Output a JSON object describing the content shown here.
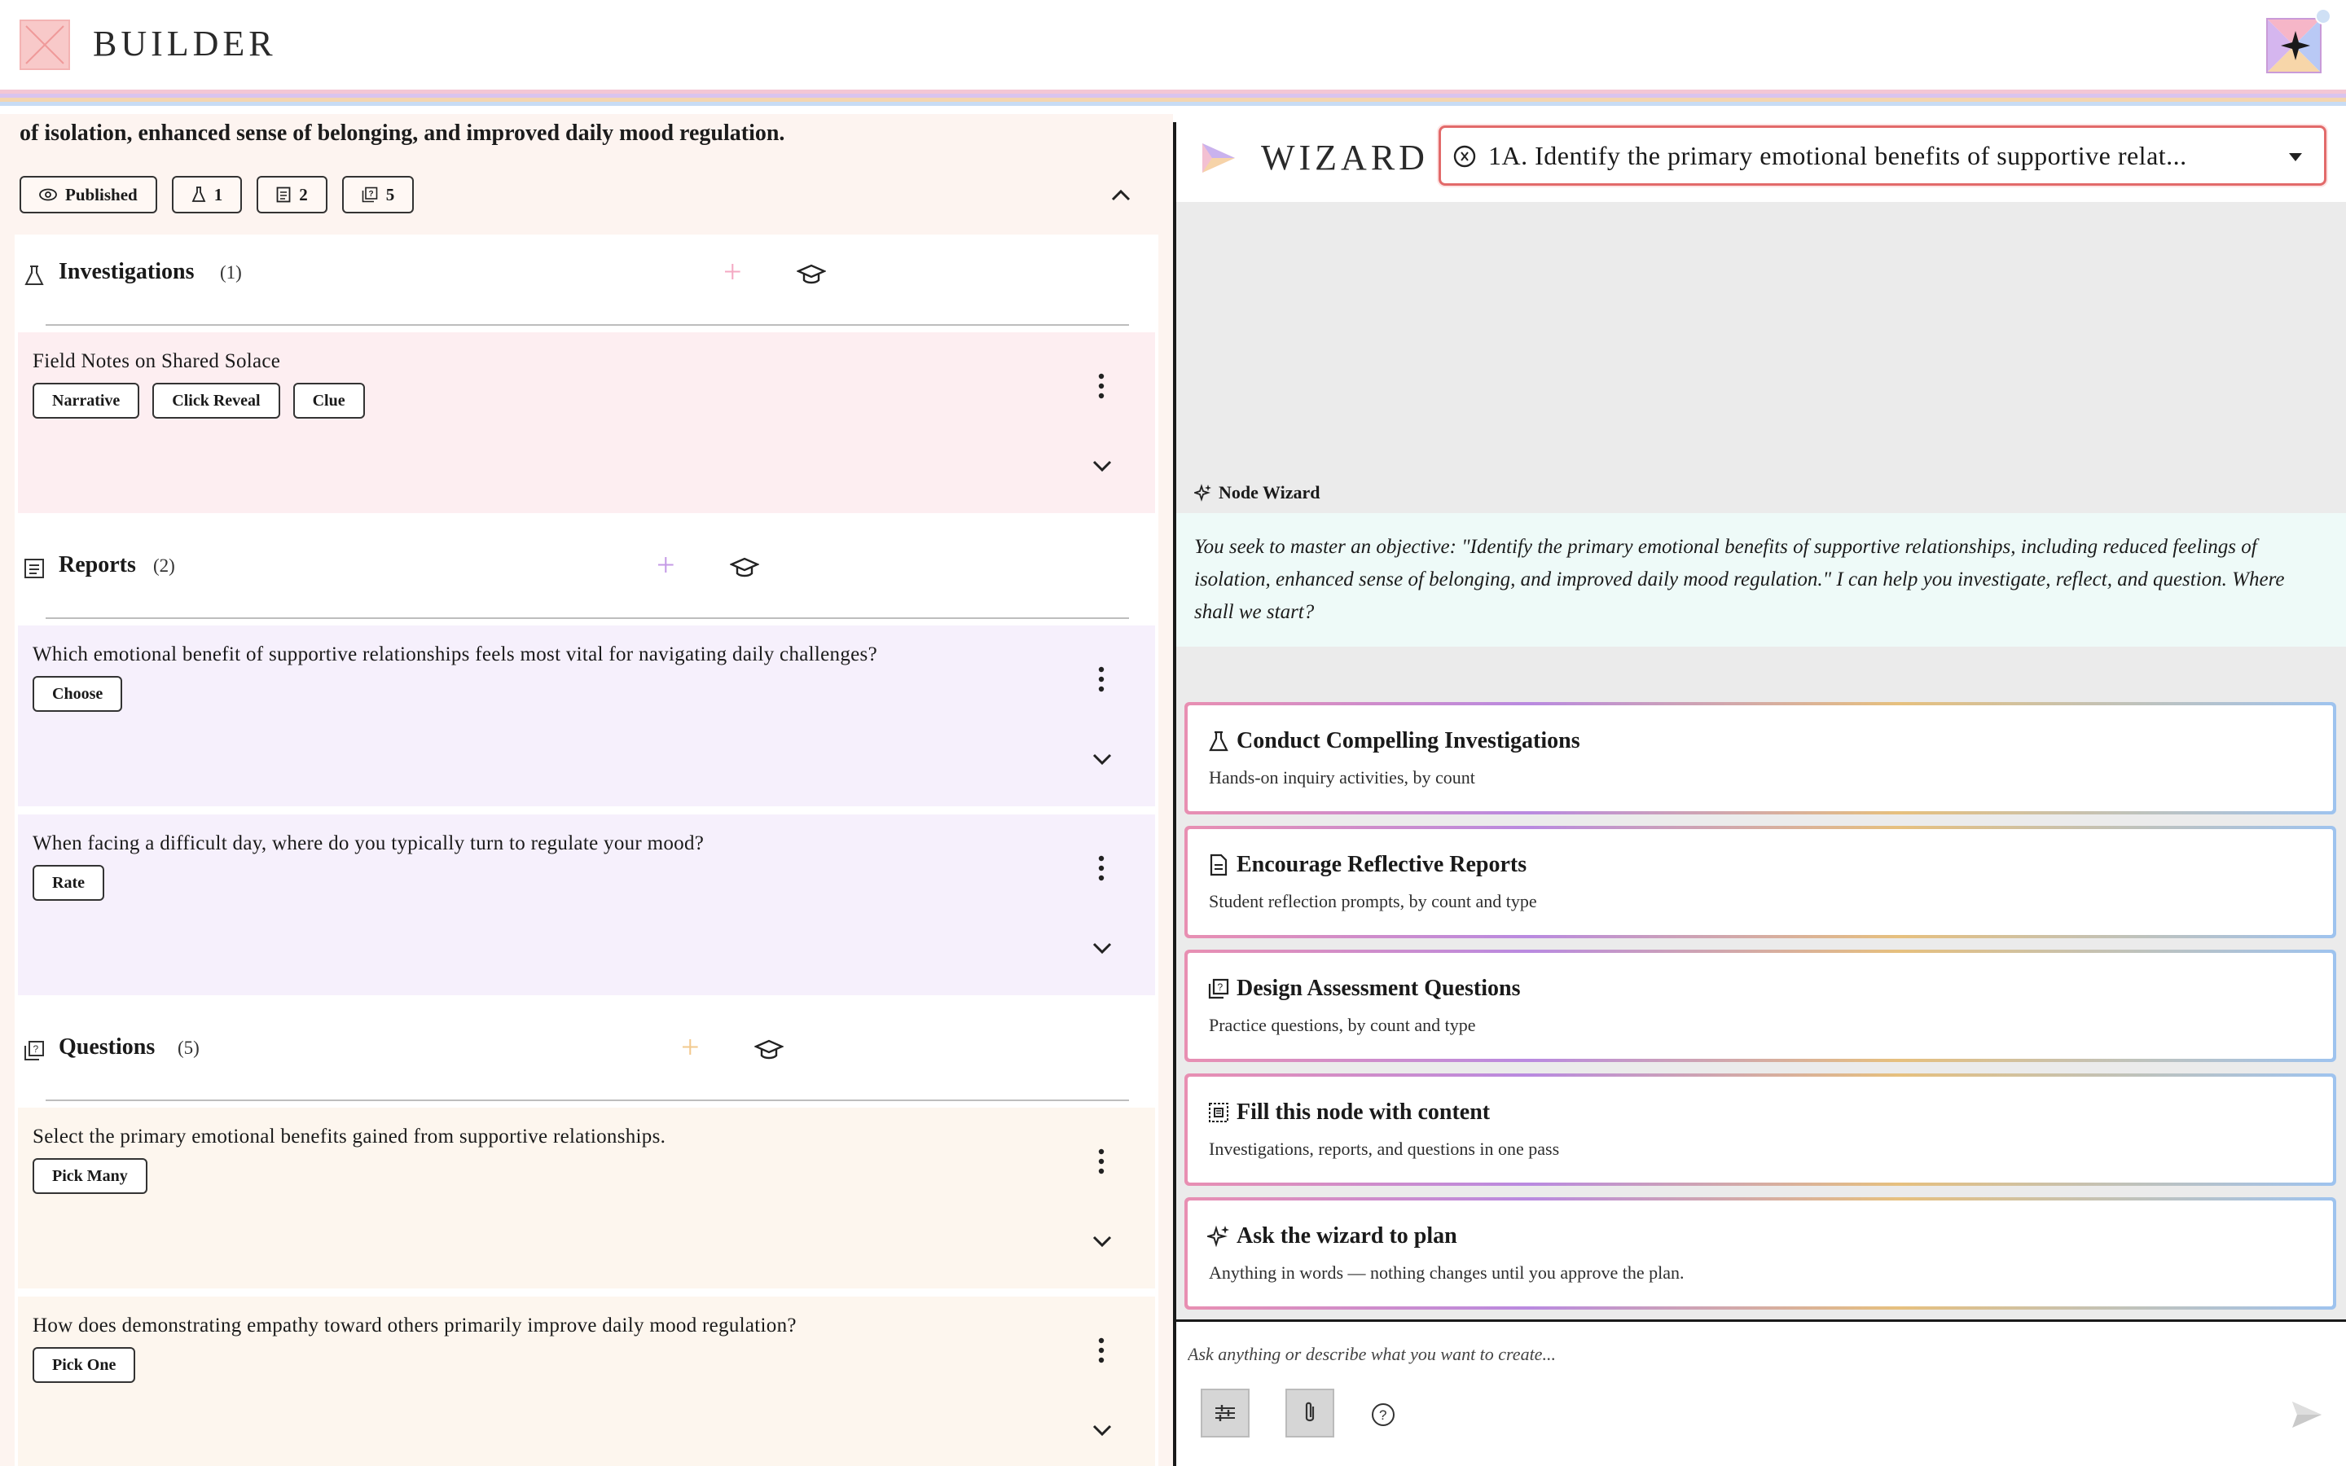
{
  "header": {
    "app_title": "BUILDER",
    "stripe_colors": [
      "#f3c6d4",
      "#d9c4ee",
      "#f4d5b0",
      "#c8dcf4"
    ]
  },
  "objective": {
    "text_tail": "of isolation, enhanced sense of belonging, and improved daily mood regulation.",
    "chips": [
      {
        "icon": "eye-icon",
        "label": "Published"
      },
      {
        "icon": "flask-icon",
        "label": "1"
      },
      {
        "icon": "report-icon",
        "label": "2"
      },
      {
        "icon": "question-icon",
        "label": "5"
      }
    ]
  },
  "investigations": {
    "title": "Investigations",
    "count": "(1)",
    "accent": "#f4a9c3",
    "card_bg": "#fdeef1",
    "cards": [
      {
        "title": "Field Notes on Shared Solace",
        "tags": [
          "Narrative",
          "Click Reveal",
          "Clue"
        ]
      }
    ]
  },
  "reports": {
    "title": "Reports",
    "count": "(2)",
    "accent": "#c49ae6",
    "card_bg": "#f6f0fc",
    "cards": [
      {
        "title": "Which emotional benefit of supportive relationships feels most vital for navigating daily challenges?",
        "tags": [
          "Choose"
        ]
      },
      {
        "title": "When facing a difficult day, where do you typically turn to regulate your mood?",
        "tags": [
          "Rate"
        ]
      }
    ]
  },
  "questions": {
    "title": "Questions",
    "count": "(5)",
    "accent": "#f2c98e",
    "card_bg": "#fdf6ee",
    "cards": [
      {
        "title": "Select the primary emotional benefits gained from supportive relationships.",
        "tags": [
          "Pick Many"
        ]
      },
      {
        "title": "How does demonstrating empathy toward others primarily improve daily mood regulation?",
        "tags": [
          "Pick One"
        ]
      }
    ]
  },
  "wizard": {
    "title": "WIZARD",
    "selected_objective": "1A. Identify the primary emotional benefits of supportive relat...",
    "node_wizard_label": "Node Wizard",
    "message": "You seek to master an objective: \"Identify the primary emotional benefits of supportive relationships, including reduced feelings of isolation, enhanced sense of belonging, and improved daily mood regulation.\" I can help you investigate, reflect, and question. Where shall we start?",
    "actions": [
      {
        "icon": "flask-icon",
        "title": "Conduct Compelling Investigations",
        "desc": "Hands-on inquiry activities, by count"
      },
      {
        "icon": "report-icon",
        "title": "Encourage Reflective Reports",
        "desc": "Student reflection prompts, by count and type"
      },
      {
        "icon": "question-icon",
        "title": "Design Assessment Questions",
        "desc": "Practice questions, by count and type"
      },
      {
        "icon": "fill-icon",
        "title": "Fill this node with content",
        "desc": "Investigations, reports, and questions in one pass"
      },
      {
        "icon": "sparkle-icon",
        "title": "Ask the wizard to plan",
        "desc": "Anything in words — nothing changes until you approve the plan."
      }
    ],
    "input_placeholder": "Ask anything or describe what you want to create..."
  }
}
